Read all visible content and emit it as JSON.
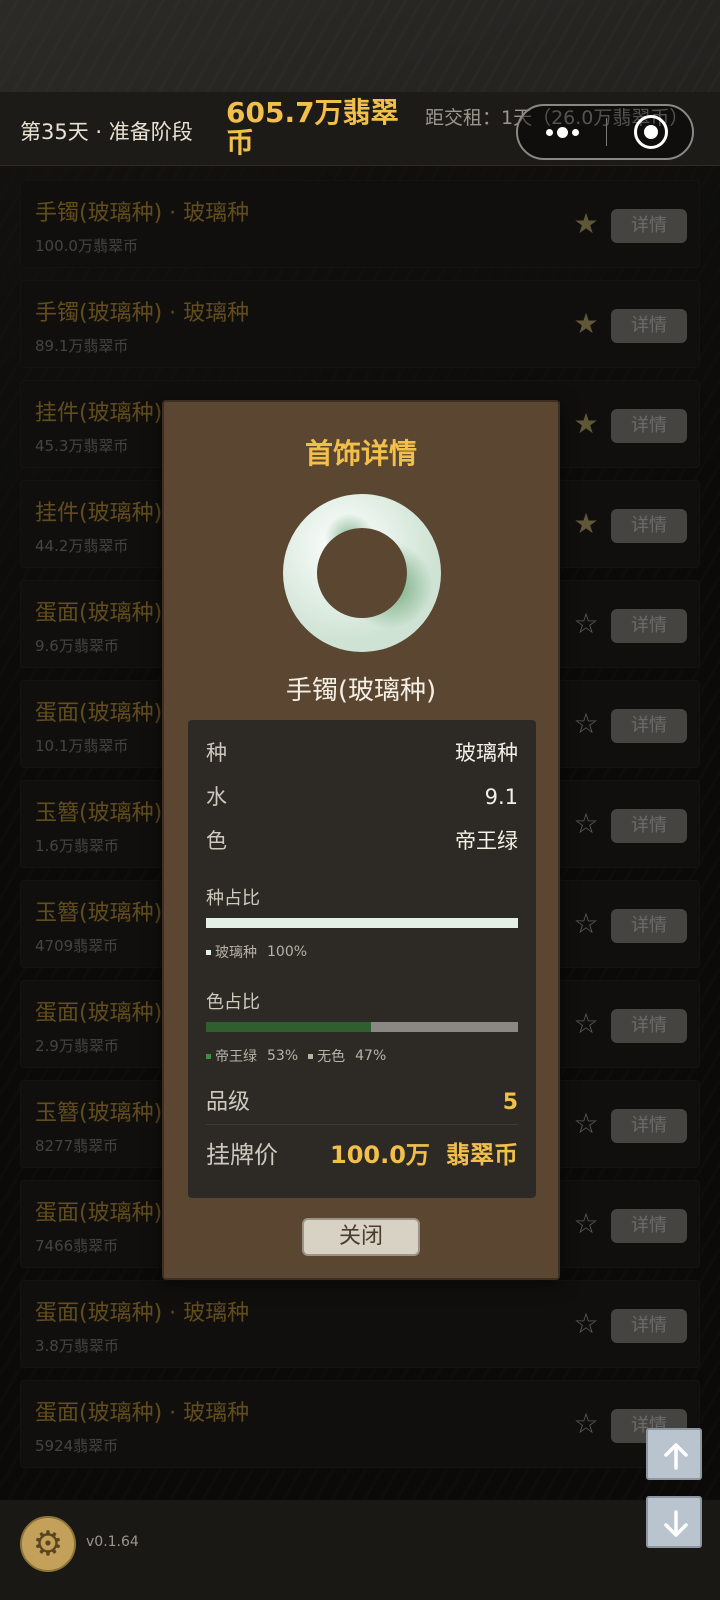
{
  "header": {
    "day_label": "第35天 · 准备阶段",
    "balance": "605.7万翡翠币",
    "rent_due": "距交租：1天（26.0万翡翠币）"
  },
  "list": {
    "items": [
      {
        "title": "手镯(玻璃种) · 玻璃种",
        "price": "100.0万翡翠币",
        "starred": true,
        "detail_label": "详情"
      },
      {
        "title": "手镯(玻璃种) · 玻璃种",
        "price": "89.1万翡翠币",
        "starred": true,
        "detail_label": "详情"
      },
      {
        "title": "挂件(玻璃种) · 玻璃种",
        "price": "45.3万翡翠币",
        "starred": true,
        "detail_label": "详情"
      },
      {
        "title": "挂件(玻璃种) · 玻璃种",
        "price": "44.2万翡翠币",
        "starred": true,
        "detail_label": "详情"
      },
      {
        "title": "蛋面(玻璃种) · 玻璃种",
        "price": "9.6万翡翠币",
        "starred": false,
        "detail_label": "详情"
      },
      {
        "title": "蛋面(玻璃种) · 玻璃种",
        "price": "10.1万翡翠币",
        "starred": false,
        "detail_label": "详情"
      },
      {
        "title": "玉簪(玻璃种) · 玻璃种",
        "price": "1.6万翡翠币",
        "starred": false,
        "detail_label": "详情"
      },
      {
        "title": "玉簪(玻璃种) · 玻璃种",
        "price": "4709翡翠币",
        "starred": false,
        "detail_label": "详情"
      },
      {
        "title": "蛋面(玻璃种) · 玻璃种",
        "price": "2.9万翡翠币",
        "starred": false,
        "detail_label": "详情"
      },
      {
        "title": "玉簪(玻璃种) · 玻璃种",
        "price": "8277翡翠币",
        "starred": false,
        "detail_label": "详情"
      },
      {
        "title": "蛋面(玻璃种) · 玻璃种",
        "price": "7466翡翠币",
        "starred": false,
        "detail_label": "详情"
      },
      {
        "title": "蛋面(玻璃种) · 玻璃种",
        "price": "3.8万翡翠币",
        "starred": false,
        "detail_label": "详情"
      },
      {
        "title": "蛋面(玻璃种) · 玻璃种",
        "price": "5924翡翠币",
        "starred": false,
        "detail_label": "详情"
      }
    ]
  },
  "modal": {
    "title": "首饰详情",
    "item_name": "手镯(玻璃种)",
    "props": {
      "variety_key": "种",
      "variety_value": "玻璃种",
      "water_key": "水",
      "water_value": "9.1",
      "color_key": "色",
      "color_value": "帝王绿"
    },
    "variety_ratio": {
      "label": "种占比",
      "segments": [
        {
          "name": "玻璃种",
          "percent_label": "100%",
          "fraction": 1.0,
          "color": "#e4efe6"
        }
      ]
    },
    "color_ratio": {
      "label": "色占比",
      "segments": [
        {
          "name": "帝王绿",
          "percent_label": "53%",
          "fraction": 0.53,
          "color": "#2f5f2e"
        },
        {
          "name": "无色",
          "percent_label": "47%",
          "fraction": 0.47,
          "color": "#8a8884"
        }
      ]
    },
    "grade_key": "品级",
    "grade_value": "5",
    "listed_key": "挂牌价",
    "listed_value": "100.0万",
    "listed_unit": "翡翠币",
    "close_label": "关闭"
  },
  "footer": {
    "version": "v0.1.64"
  },
  "colors": {
    "accent_gold": "#f2c04a",
    "modal_brown": "#5b4631",
    "jade_green": "#2f5f2e"
  },
  "icons": [
    "more-icon",
    "exit-icon",
    "star-icon",
    "gear-icon",
    "arrow-up-icon",
    "arrow-down-icon",
    "jade-bangle-icon"
  ]
}
